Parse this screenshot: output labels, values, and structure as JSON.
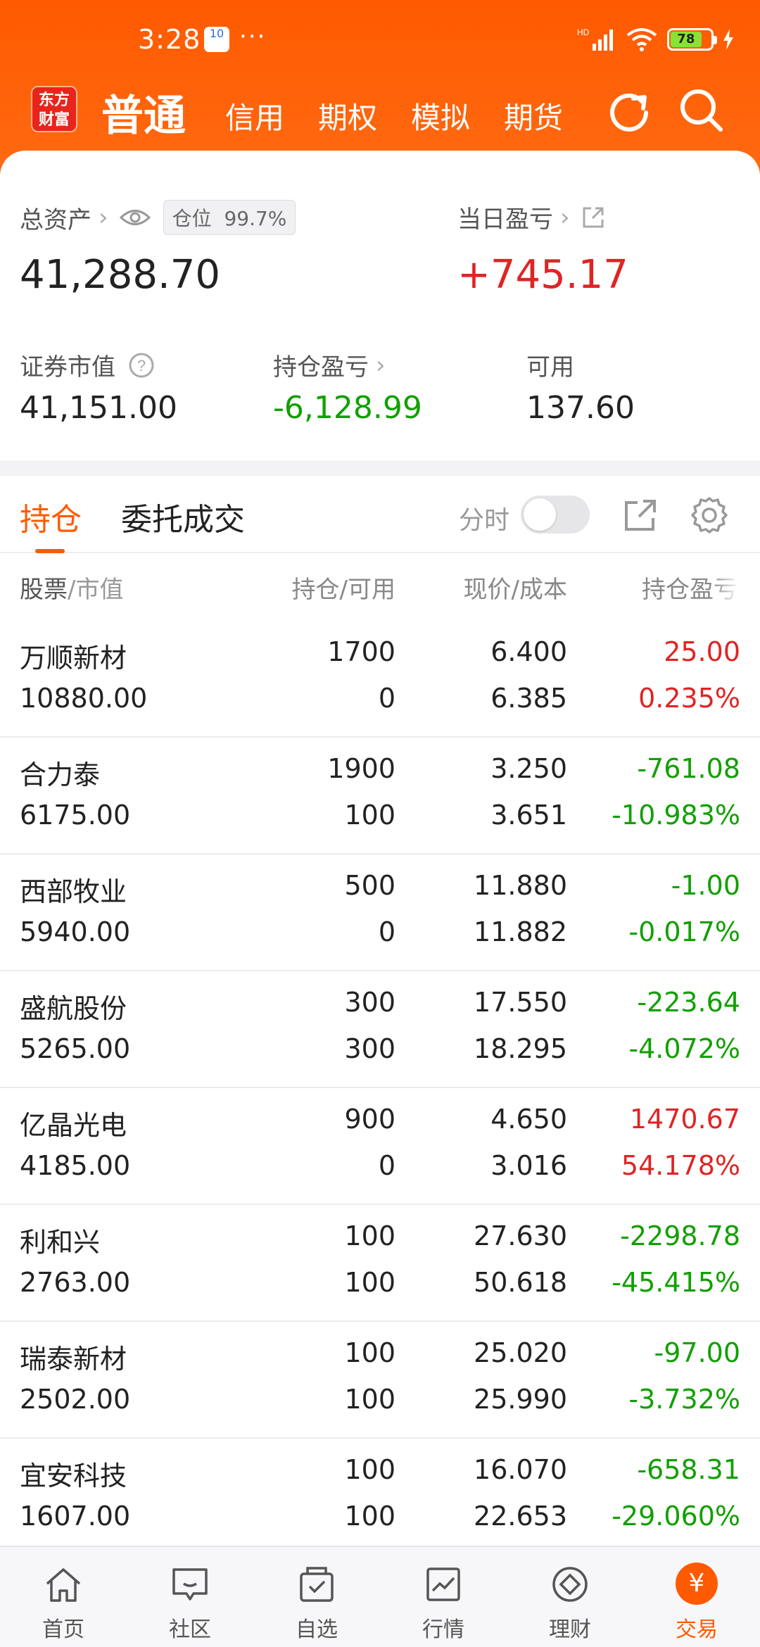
{
  "status_bar": {
    "time": "3:28",
    "notif_badge": "10",
    "dots": "···",
    "battery": "78"
  },
  "header": {
    "logo": "东方\n财富",
    "tabs": [
      "普通",
      "信用",
      "期权",
      "模拟",
      "期货"
    ]
  },
  "summary": {
    "total_assets_label": "总资产",
    "position_label": "仓位",
    "position_value": "99.7%",
    "total_assets": "41,288.70",
    "daily_pl_label": "当日盈亏",
    "daily_pl": "+745.17",
    "market_value_label": "证券市值",
    "market_value": "41,151.00",
    "holding_pl_label": "持仓盈亏",
    "holding_pl": "-6,128.99",
    "available_label": "可用",
    "available": "137.60"
  },
  "tabs": {
    "holdings": "持仓",
    "orders": "委托成交",
    "fenshi": "分时"
  },
  "table": {
    "headers": {
      "name": "股票",
      "name_sub": "/市值",
      "position": "持仓/可用",
      "price": "现价/成本",
      "pl": "持仓盈亏"
    },
    "rows": [
      {
        "name": "万顺新材",
        "mv": "10880.00",
        "pos": "1700",
        "avail": "0",
        "price": "6.400",
        "cost": "6.385",
        "pl": "25.00",
        "plp": "0.235%",
        "dir": "up"
      },
      {
        "name": "合力泰",
        "mv": "6175.00",
        "pos": "1900",
        "avail": "100",
        "price": "3.250",
        "cost": "3.651",
        "pl": "-761.08",
        "plp": "-10.983%",
        "dir": "down"
      },
      {
        "name": "西部牧业",
        "mv": "5940.00",
        "pos": "500",
        "avail": "0",
        "price": "11.880",
        "cost": "11.882",
        "pl": "-1.00",
        "plp": "-0.017%",
        "dir": "down"
      },
      {
        "name": "盛航股份",
        "mv": "5265.00",
        "pos": "300",
        "avail": "300",
        "price": "17.550",
        "cost": "18.295",
        "pl": "-223.64",
        "plp": "-4.072%",
        "dir": "down"
      },
      {
        "name": "亿晶光电",
        "mv": "4185.00",
        "pos": "900",
        "avail": "0",
        "price": "4.650",
        "cost": "3.016",
        "pl": "1470.67",
        "plp": "54.178%",
        "dir": "up"
      },
      {
        "name": "利和兴",
        "mv": "2763.00",
        "pos": "100",
        "avail": "100",
        "price": "27.630",
        "cost": "50.618",
        "pl": "-2298.78",
        "plp": "-45.415%",
        "dir": "down"
      },
      {
        "name": "瑞泰新材",
        "mv": "2502.00",
        "pos": "100",
        "avail": "100",
        "price": "25.020",
        "cost": "25.990",
        "pl": "-97.00",
        "plp": "-3.732%",
        "dir": "down"
      },
      {
        "name": "宜安科技",
        "mv": "1607.00",
        "pos": "100",
        "avail": "100",
        "price": "16.070",
        "cost": "22.653",
        "pl": "-658.31",
        "plp": "-29.060%",
        "dir": "down"
      }
    ]
  },
  "bottom_nav": [
    "首页",
    "社区",
    "自选",
    "行情",
    "理财",
    "交易"
  ],
  "trade_glyph": "¥",
  "colors": {
    "brand": "#ff5a00",
    "up": "#e02424",
    "down": "#11a000"
  }
}
